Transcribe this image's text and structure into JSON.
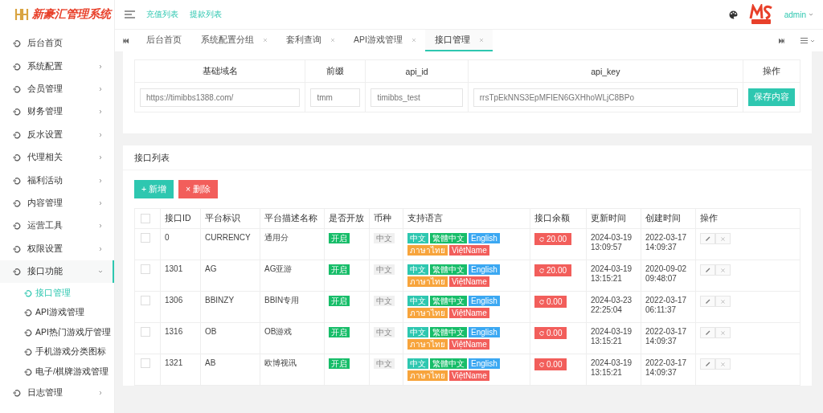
{
  "app": {
    "title": "新豪汇管理系统"
  },
  "header": {
    "links": [
      {
        "label": "充值列表"
      },
      {
        "label": "提款列表"
      }
    ],
    "user": "admin"
  },
  "sidebar": {
    "items": [
      {
        "label": "后台首页",
        "expandable": false,
        "expanded": false
      },
      {
        "label": "系统配置",
        "expandable": true,
        "expanded": false
      },
      {
        "label": "会员管理",
        "expandable": true,
        "expanded": false
      },
      {
        "label": "财务管理",
        "expandable": true,
        "expanded": false
      },
      {
        "label": "反水设置",
        "expandable": true,
        "expanded": false
      },
      {
        "label": "代理相关",
        "expandable": true,
        "expanded": false
      },
      {
        "label": "福利活动",
        "expandable": true,
        "expanded": false
      },
      {
        "label": "内容管理",
        "expandable": true,
        "expanded": false
      },
      {
        "label": "运营工具",
        "expandable": true,
        "expanded": false
      },
      {
        "label": "权限设置",
        "expandable": true,
        "expanded": false
      },
      {
        "label": "接口功能",
        "expandable": true,
        "expanded": true,
        "children": [
          {
            "label": "接口管理",
            "selected": true
          },
          {
            "label": "API游戏管理",
            "selected": false
          },
          {
            "label": "API热门游戏厅管理",
            "selected": false
          },
          {
            "label": "手机游戏分类图标",
            "selected": false
          },
          {
            "label": "电子/棋牌游戏管理",
            "selected": false
          }
        ]
      },
      {
        "label": "日志管理",
        "expandable": true,
        "expanded": false
      }
    ]
  },
  "tabs": [
    {
      "label": "后台首页",
      "closable": false,
      "selected": false
    },
    {
      "label": "系统配置分组",
      "closable": true,
      "selected": false
    },
    {
      "label": "套利查询",
      "closable": true,
      "selected": false
    },
    {
      "label": "API游戏管理",
      "closable": true,
      "selected": false
    },
    {
      "label": "接口管理",
      "closable": true,
      "selected": true
    }
  ],
  "config": {
    "columns": [
      "基础域名",
      "前缀",
      "api_id",
      "api_key",
      "操作"
    ],
    "values": [
      "https://timibbs1388.com/",
      "tmm",
      "timibbs_test",
      "rrsTpEkNNS3EpMFIEN6GXHhoWLjC8BPo"
    ],
    "save_button": "保存内容"
  },
  "list": {
    "title": "接口列表",
    "buttons": [
      {
        "kind": "add",
        "icon": "+",
        "label": "新增"
      },
      {
        "kind": "delete",
        "icon": "×",
        "label": "删除"
      }
    ],
    "select_all": {
      "checked": false
    },
    "columns": [
      "接口ID",
      "平台标识",
      "平台描述名称",
      "是否开放",
      "币种",
      "支持语言",
      "接口余额",
      "更新时间",
      "创建时间",
      "操作"
    ],
    "rows": [
      {
        "checked": false,
        "id": "0",
        "platform": "CURRENCY",
        "name": "通用分",
        "open": "开启",
        "currency": "中文",
        "languages": [
          {
            "label": "中文",
            "color": "#2ec7b0"
          },
          {
            "label": "繁體中文",
            "color": "#17bd69"
          },
          {
            "label": "English",
            "color": "#3ba8f2"
          },
          {
            "label": "ภาษาไทย",
            "color": "#f7a43c"
          },
          {
            "label": "ViệtName",
            "color": "#f25e5b"
          }
        ],
        "balance": "20.00",
        "updated": "2024-03-19 13:09:57",
        "created": "2022-03-17 14:09:37"
      },
      {
        "checked": false,
        "id": "1301",
        "platform": "AG",
        "name": "AG亚游",
        "open": "开启",
        "currency": "中文",
        "languages": [
          {
            "label": "中文",
            "color": "#2ec7b0"
          },
          {
            "label": "繁體中文",
            "color": "#17bd69"
          },
          {
            "label": "English",
            "color": "#3ba8f2"
          },
          {
            "label": "ภาษาไทย",
            "color": "#f7a43c"
          },
          {
            "label": "ViệtName",
            "color": "#f25e5b"
          }
        ],
        "balance": "20.00",
        "updated": "2024-03-19 13:15:21",
        "created": "2020-09-02 09:48:07"
      },
      {
        "checked": false,
        "id": "1306",
        "platform": "BBINZY",
        "name": "BBIN专用",
        "open": "开启",
        "currency": "中文",
        "languages": [
          {
            "label": "中文",
            "color": "#2ec7b0"
          },
          {
            "label": "繁體中文",
            "color": "#17bd69"
          },
          {
            "label": "English",
            "color": "#3ba8f2"
          },
          {
            "label": "ภาษาไทย",
            "color": "#f7a43c"
          },
          {
            "label": "ViệtName",
            "color": "#f25e5b"
          }
        ],
        "balance": "0.00",
        "updated": "2024-03-23 22:25:04",
        "created": "2022-03-17 06:11:37"
      },
      {
        "checked": false,
        "id": "1316",
        "platform": "OB",
        "name": "OB游戏",
        "open": "开启",
        "currency": "中文",
        "languages": [
          {
            "label": "中文",
            "color": "#2ec7b0"
          },
          {
            "label": "繁體中文",
            "color": "#17bd69"
          },
          {
            "label": "English",
            "color": "#3ba8f2"
          },
          {
            "label": "ภาษาไทย",
            "color": "#f7a43c"
          },
          {
            "label": "ViệtName",
            "color": "#f25e5b"
          }
        ],
        "balance": "0.00",
        "updated": "2024-03-19 13:15:21",
        "created": "2022-03-17 14:09:37"
      },
      {
        "checked": false,
        "id": "1321",
        "platform": "AB",
        "name": "欧博视讯",
        "open": "开启",
        "currency": "中文",
        "languages": [
          {
            "label": "中文",
            "color": "#2ec7b0"
          },
          {
            "label": "繁體中文",
            "color": "#17bd69"
          },
          {
            "label": "English",
            "color": "#3ba8f2"
          },
          {
            "label": "ภาษาไทย",
            "color": "#f7a43c"
          },
          {
            "label": "ViệtName",
            "color": "#f25e5b"
          }
        ],
        "balance": "0.00",
        "updated": "2024-03-19 13:15:21",
        "created": "2022-03-17 14:09:37"
      }
    ]
  }
}
